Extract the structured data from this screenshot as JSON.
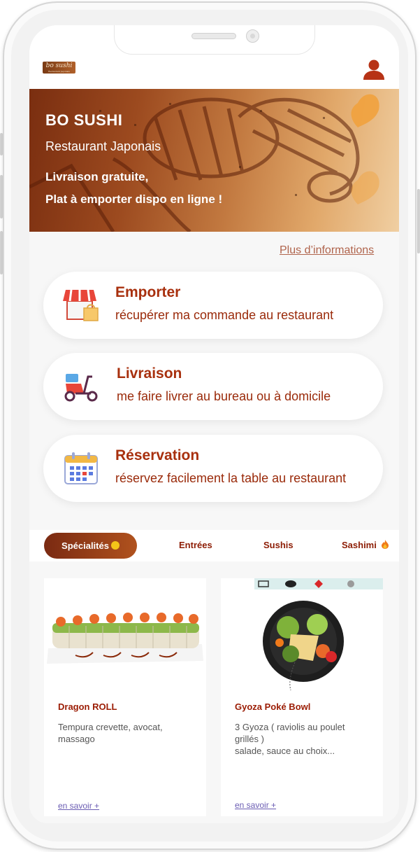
{
  "header": {
    "logo_text": "bo sushi",
    "logo_tagline": "Restaurant Japonais",
    "user_icon": "user-icon"
  },
  "hero": {
    "title": "BO SUSHI",
    "subtitle": "Restaurant Japonais",
    "line1": "Livraison gratuite,",
    "line2": "Plat à emporter dispo en ligne !"
  },
  "more_info_link": "Plus d’informations",
  "services": [
    {
      "title": "Emporter",
      "description": "récupérer ma commande au restaurant",
      "icon": "store-icon"
    },
    {
      "title": "Livraison",
      "description": "me faire livrer au bureau ou à domicile",
      "icon": "scooter-icon"
    },
    {
      "title": "Réservation",
      "description": "réservez facilement la table au restaurant",
      "icon": "calendar-icon"
    }
  ],
  "tabs": [
    {
      "label": "Spécialités",
      "active": true,
      "icon": "smiley-icon"
    },
    {
      "label": "Entrées"
    },
    {
      "label": "Sushis"
    },
    {
      "label": "Sashimi",
      "icon": "fire-icon"
    }
  ],
  "products": [
    {
      "name": "Dragon ROLL",
      "description": "Tempura crevette, avocat,\nmassago",
      "link": "en savoir +"
    },
    {
      "name": "Gyoza Poké Bowl",
      "description": "3 Gyoza ( raviolis au poulet\ngrillés )\nsalade, sauce au choix...",
      "link": "en savoir +"
    }
  ],
  "colors": {
    "accent": "#a8300e",
    "tab_active_bg": "#7a2a12",
    "link": "#b0644c"
  }
}
